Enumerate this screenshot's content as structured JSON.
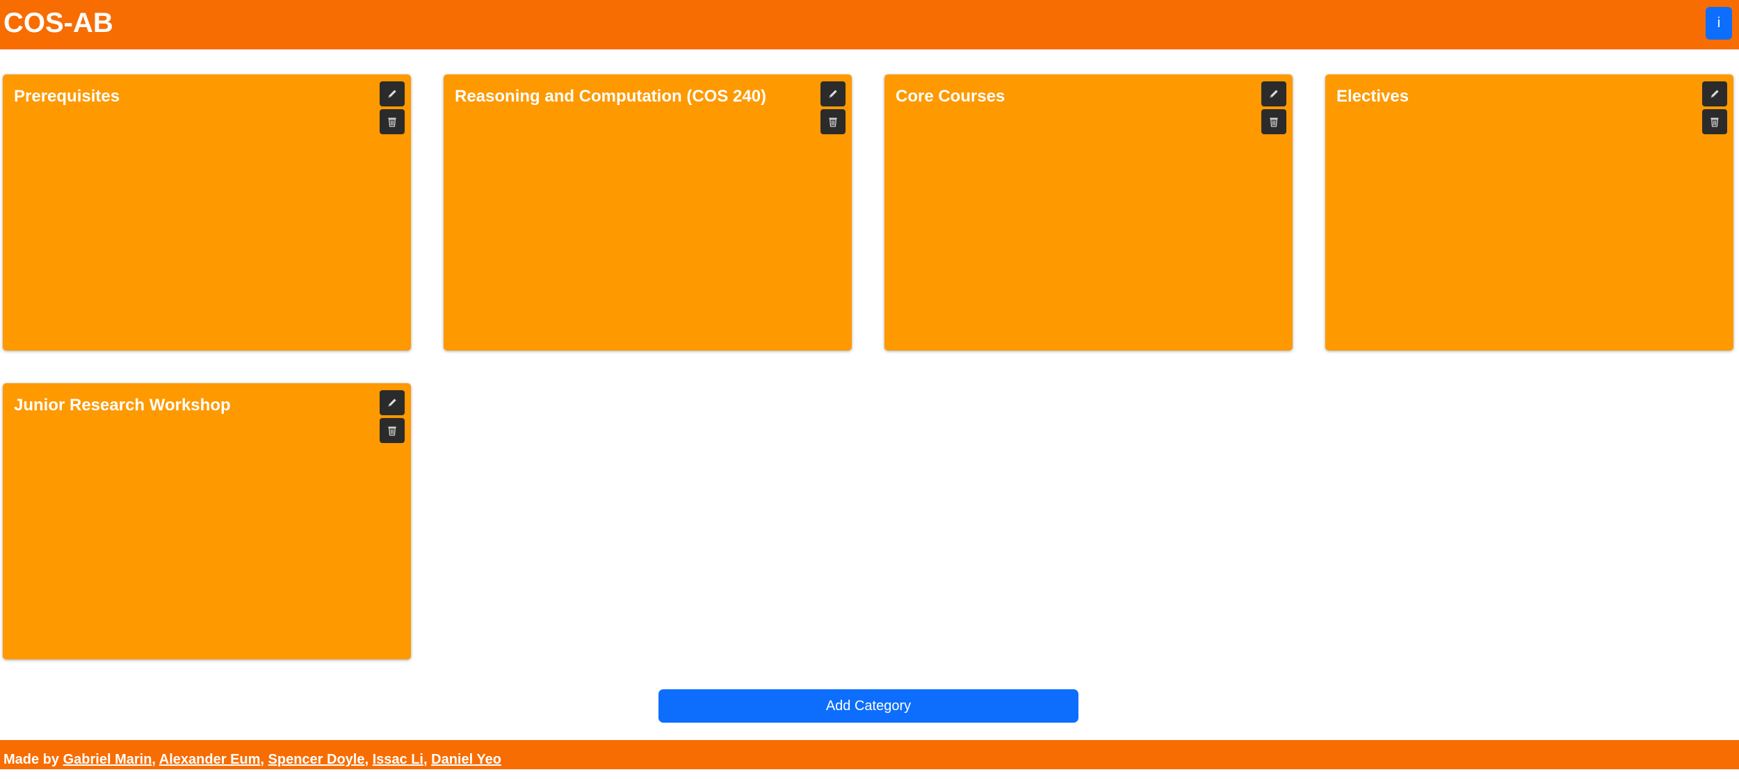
{
  "header": {
    "title": "COS-AB",
    "info_label": "i"
  },
  "categories": [
    {
      "title": "Prerequisites",
      "edit_icon": "pencil-icon",
      "delete_icon": "trash-icon"
    },
    {
      "title": "Reasoning and Computation (COS 240)",
      "edit_icon": "pencil-icon",
      "delete_icon": "trash-icon"
    },
    {
      "title": "Core Courses",
      "edit_icon": "pencil-icon",
      "delete_icon": "trash-icon"
    },
    {
      "title": "Electives",
      "edit_icon": "pencil-icon",
      "delete_icon": "trash-icon"
    },
    {
      "title": "Junior Research Workshop",
      "edit_icon": "pencil-icon",
      "delete_icon": "trash-icon"
    }
  ],
  "add_category_label": "Add Category",
  "footer": {
    "prefix": "Made by",
    "authors": [
      "Gabriel Marin",
      "Alexander Eum",
      "Spencer Doyle",
      "Issac Li",
      "Daniel Yeo"
    ],
    "separator": ","
  },
  "colors": {
    "header": "#f76d02",
    "card": "#fe9900",
    "primary_button": "#0d6efd",
    "icon_button": "#2b2b2b"
  }
}
